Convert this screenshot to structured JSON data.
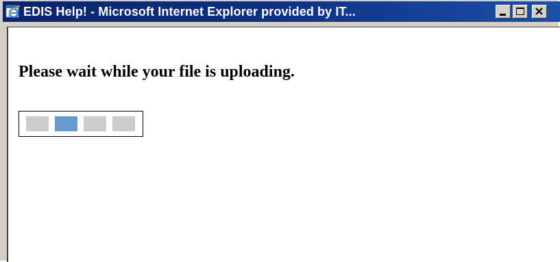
{
  "window": {
    "title": "EDIS Help! - Microsoft Internet Explorer provided by IT..."
  },
  "titlebar_controls": {
    "minimize_icon": "minimize-icon",
    "maximize_icon": "maximize-icon",
    "close_icon": "close-icon"
  },
  "content": {
    "message": "Please wait while your file is uploading."
  },
  "progress": {
    "segments": 4,
    "active_segment_index": 1,
    "inactive_color": "#cccccc",
    "active_color": "#6699cc"
  },
  "colors": {
    "titlebar_start": "#0a246a",
    "titlebar_end": "#1c4fa8",
    "chrome": "#d4d0c8"
  }
}
